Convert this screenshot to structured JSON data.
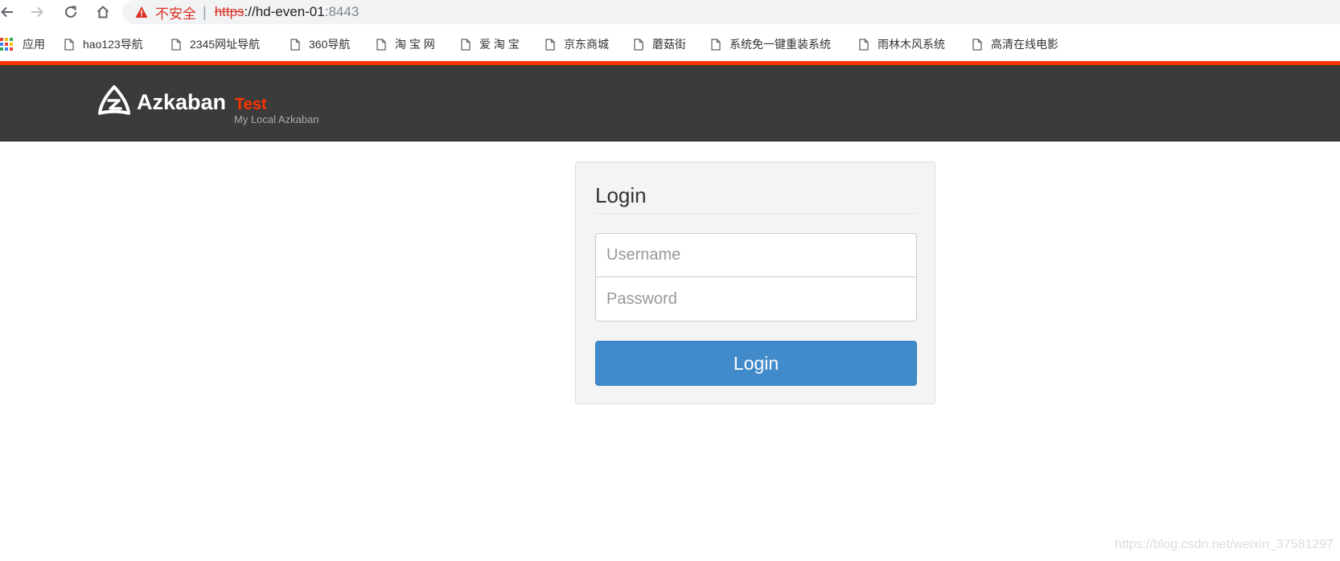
{
  "browser": {
    "security_label": "不安全",
    "separator": "|",
    "url_scheme": "https",
    "url_rest": "://hd-even-01",
    "url_port": ":8443",
    "apps_colors": [
      "#ea4335",
      "#fbbc05",
      "#34a853",
      "#4285f4",
      "#ea4335",
      "#fbbc05",
      "#34a853",
      "#4285f4",
      "#ea4335"
    ]
  },
  "bookmarks": [
    {
      "label": "应用",
      "icon": "apps-grid-icon"
    },
    {
      "label": "hao123导航",
      "icon": "page-icon"
    },
    {
      "label": "2345网址导航",
      "icon": "page-icon"
    },
    {
      "label": "360导航",
      "icon": "page-icon"
    },
    {
      "label": "淘 宝 网",
      "icon": "page-icon"
    },
    {
      "label": "爱 淘 宝",
      "icon": "page-icon"
    },
    {
      "label": "京东商城",
      "icon": "page-icon"
    },
    {
      "label": "蘑菇街",
      "icon": "page-icon"
    },
    {
      "label": "系统免一键重装系统",
      "icon": "page-icon"
    },
    {
      "label": "雨林木风系统",
      "icon": "page-icon"
    },
    {
      "label": "高清在线电影",
      "icon": "page-icon"
    }
  ],
  "header": {
    "brand": "Azkaban",
    "env_name": "Test",
    "env_description": "My Local Azkaban",
    "accent_color": "#ff3300",
    "bar_color": "#3b3b3b"
  },
  "login": {
    "title": "Login",
    "username_placeholder": "Username",
    "password_placeholder": "Password",
    "button_label": "Login",
    "button_color": "#428bca"
  },
  "watermark": "https://blog.csdn.net/weixin_37581297"
}
